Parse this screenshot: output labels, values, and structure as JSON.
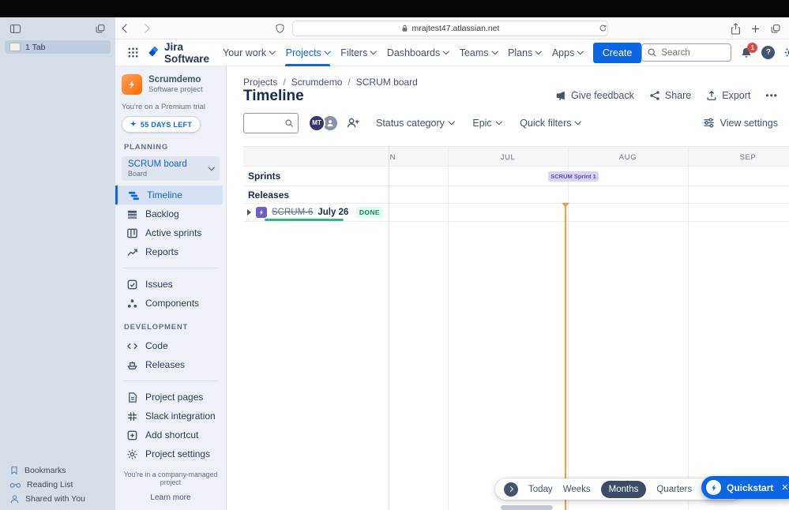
{
  "browser": {
    "tab_label": "1 Tab",
    "url": "mrajtest47.atlassian.net",
    "bottom_items": [
      {
        "label": "Bookmarks"
      },
      {
        "label": "Reading List"
      },
      {
        "label": "Shared with You"
      }
    ]
  },
  "topnav": {
    "logo_text": "Jira Software",
    "items": [
      {
        "label": "Your work"
      },
      {
        "label": "Projects"
      },
      {
        "label": "Filters"
      },
      {
        "label": "Dashboards"
      },
      {
        "label": "Teams"
      },
      {
        "label": "Plans"
      },
      {
        "label": "Apps"
      }
    ],
    "create_label": "Create",
    "search_placeholder": "Search",
    "notification_badge": "1",
    "avatar_initials": "MT"
  },
  "sidebar": {
    "project_name": "Scrumdemo",
    "project_type": "Software project",
    "trial_text": "You're on a Premium trial",
    "trial_days": "55 DAYS LEFT",
    "planning_header": "PLANNING",
    "board_switcher": {
      "title": "SCRUM board",
      "subtitle": "Board"
    },
    "planning_items": [
      {
        "label": "Timeline"
      },
      {
        "label": "Backlog"
      },
      {
        "label": "Active sprints"
      },
      {
        "label": "Reports"
      }
    ],
    "general_items": [
      {
        "label": "Issues"
      },
      {
        "label": "Components"
      }
    ],
    "development_header": "DEVELOPMENT",
    "development_items": [
      {
        "label": "Code"
      },
      {
        "label": "Releases"
      }
    ],
    "extra_items": [
      {
        "label": "Project pages"
      },
      {
        "label": "Slack integration"
      },
      {
        "label": "Add shortcut"
      },
      {
        "label": "Project settings"
      }
    ],
    "footer_text": "You're in a company-managed project",
    "footer_link": "Learn more"
  },
  "main": {
    "breadcrumb": [
      "Projects",
      "Scrumdemo",
      "SCRUM board"
    ],
    "title": "Timeline",
    "actions": {
      "feedback": "Give feedback",
      "share": "Share",
      "export": "Export"
    },
    "toolbar": {
      "avatar_initials": "MT",
      "filters": [
        {
          "label": "Status category"
        },
        {
          "label": "Epic"
        },
        {
          "label": "Quick filters"
        }
      ],
      "view_settings": "View settings"
    }
  },
  "timeline": {
    "months": [
      "JUN",
      "JUL",
      "AUG",
      "SEP"
    ],
    "row_sprints": "Sprints",
    "row_releases": "Releases",
    "sprint_badge": "SCRUM Sprint 1",
    "epic": {
      "key": "SCRUM-6",
      "name": "July 26",
      "status": "DONE"
    }
  },
  "bottombar": {
    "zoom_options": [
      "Today",
      "Weeks",
      "Months",
      "Quarters"
    ],
    "selected": "Months",
    "quickstart_label": "Quickstart"
  },
  "icons": {
    "help": "?",
    "more": "•••",
    "close": "✕",
    "sparkle": "✦",
    "slash": "/"
  },
  "colors": {
    "accent_blue": "#0C66E4",
    "today_orange": "#FB9A3C",
    "progress_green": "#36B37E",
    "sprint_badge_bg": "#DCD4F7",
    "done_bg": "#DCFFF1"
  }
}
